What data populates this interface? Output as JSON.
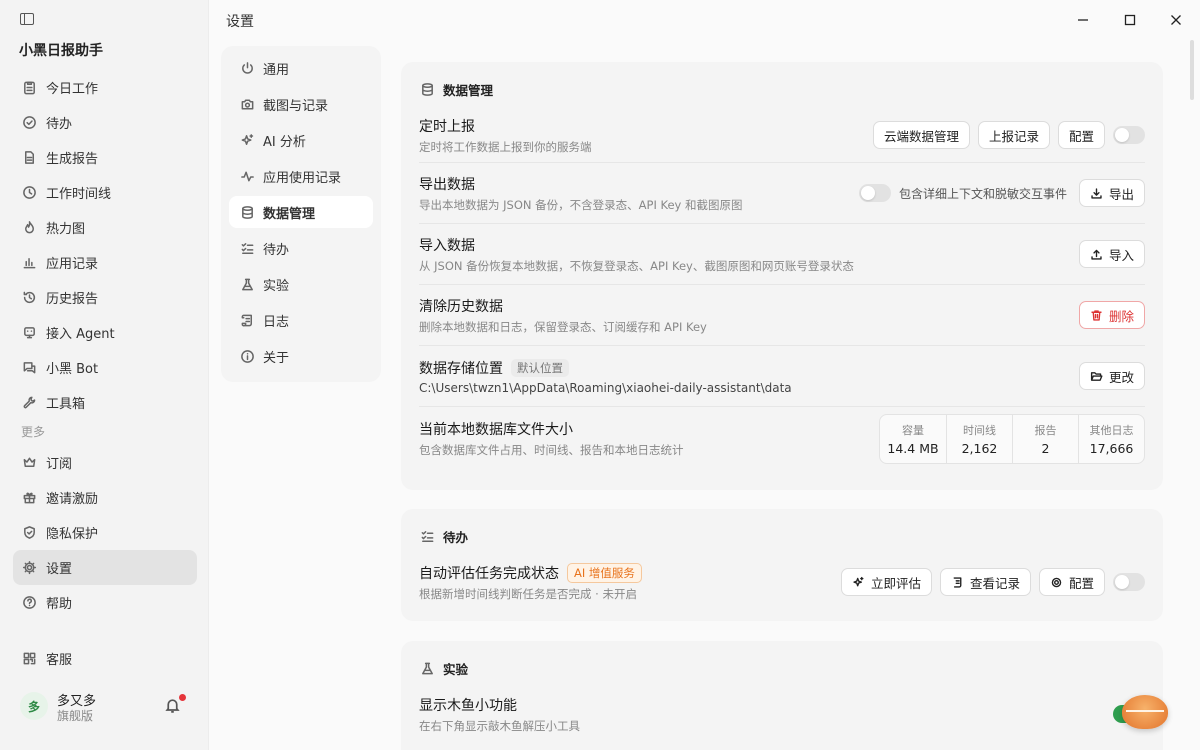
{
  "app": {
    "title": "小黑日报助手"
  },
  "sidebar": {
    "items": [
      {
        "label": "今日工作",
        "icon": "clipboard-icon"
      },
      {
        "label": "待办",
        "icon": "check-circle-icon"
      },
      {
        "label": "生成报告",
        "icon": "document-icon"
      },
      {
        "label": "工作时间线",
        "icon": "clock-icon"
      },
      {
        "label": "热力图",
        "icon": "flame-icon"
      },
      {
        "label": "应用记录",
        "icon": "bar-chart-icon"
      },
      {
        "label": "历史报告",
        "icon": "history-icon"
      },
      {
        "label": "接入 Agent",
        "icon": "plug-icon"
      },
      {
        "label": "小黑 Bot",
        "icon": "chat-icon"
      },
      {
        "label": "工具箱",
        "icon": "wrench-icon"
      }
    ],
    "more_label": "更多",
    "more_items": [
      {
        "label": "订阅",
        "icon": "crown-icon"
      },
      {
        "label": "邀请激励",
        "icon": "gift-icon"
      },
      {
        "label": "隐私保护",
        "icon": "shield-icon"
      },
      {
        "label": "设置",
        "icon": "gear-icon",
        "active": true
      },
      {
        "label": "帮助",
        "icon": "help-icon"
      }
    ],
    "support_label": "客服",
    "user": {
      "avatar_text": "多",
      "name": "多又多",
      "plan": "旗舰版"
    }
  },
  "header": {
    "title": "设置"
  },
  "settings_nav": [
    {
      "label": "通用",
      "icon": "power-icon"
    },
    {
      "label": "截图与记录",
      "icon": "camera-icon"
    },
    {
      "label": "AI 分析",
      "icon": "sparkle-icon"
    },
    {
      "label": "应用使用记录",
      "icon": "activity-icon"
    },
    {
      "label": "数据管理",
      "icon": "database-icon",
      "active": true
    },
    {
      "label": "待办",
      "icon": "checklist-icon"
    },
    {
      "label": "实验",
      "icon": "flask-icon"
    },
    {
      "label": "日志",
      "icon": "scroll-icon"
    },
    {
      "label": "关于",
      "icon": "info-icon"
    }
  ],
  "data_mgmt": {
    "title": "数据管理",
    "scheduled": {
      "title": "定时上报",
      "desc": "定时将工作数据上报到你的服务端",
      "btn_cloud": "云端数据管理",
      "btn_records": "上报记录",
      "btn_config": "配置",
      "enabled": false
    },
    "export": {
      "title": "导出数据",
      "desc": "导出本地数据为 JSON 备份，不含登录态、API Key 和截图原图",
      "toggle_label": "包含详细上下文和脱敏交互事件",
      "btn": "导出"
    },
    "import": {
      "title": "导入数据",
      "desc": "从 JSON 备份恢复本地数据，不恢复登录态、API Key、截图原图和网页账号登录状态",
      "btn": "导入"
    },
    "clear": {
      "title": "清除历史数据",
      "desc": "删除本地数据和日志，保留登录态、订阅缓存和 API Key",
      "btn": "删除"
    },
    "storage": {
      "title": "数据存储位置",
      "badge": "默认位置",
      "path": "C:\\Users\\twzn1\\AppData\\Roaming\\xiaohei-daily-assistant\\data",
      "btn": "更改"
    },
    "dbsize": {
      "title": "当前本地数据库文件大小",
      "desc": "包含数据库文件占用、时间线、报告和本地日志统计",
      "stats": [
        {
          "label": "容量",
          "value": "14.4 MB"
        },
        {
          "label": "时间线",
          "value": "2,162"
        },
        {
          "label": "报告",
          "value": "2"
        },
        {
          "label": "其他日志",
          "value": "17,666"
        }
      ]
    }
  },
  "todo": {
    "title": "待办",
    "auto": {
      "title": "自动评估任务完成状态",
      "badge": "AI 增值服务",
      "desc": "根据新增时间线判断任务是否完成 · 未开启",
      "btn_eval": "立即评估",
      "btn_records": "查看记录",
      "btn_config": "配置",
      "enabled": false
    }
  },
  "experiment": {
    "title": "实验",
    "fish": {
      "title": "显示木鱼小功能",
      "desc": "在右下角显示敲木鱼解压小工具",
      "enabled": true
    }
  },
  "colors": {
    "accent": "#2f9e4f",
    "danger": "#d33333",
    "ai_badge": "#e8731c"
  }
}
